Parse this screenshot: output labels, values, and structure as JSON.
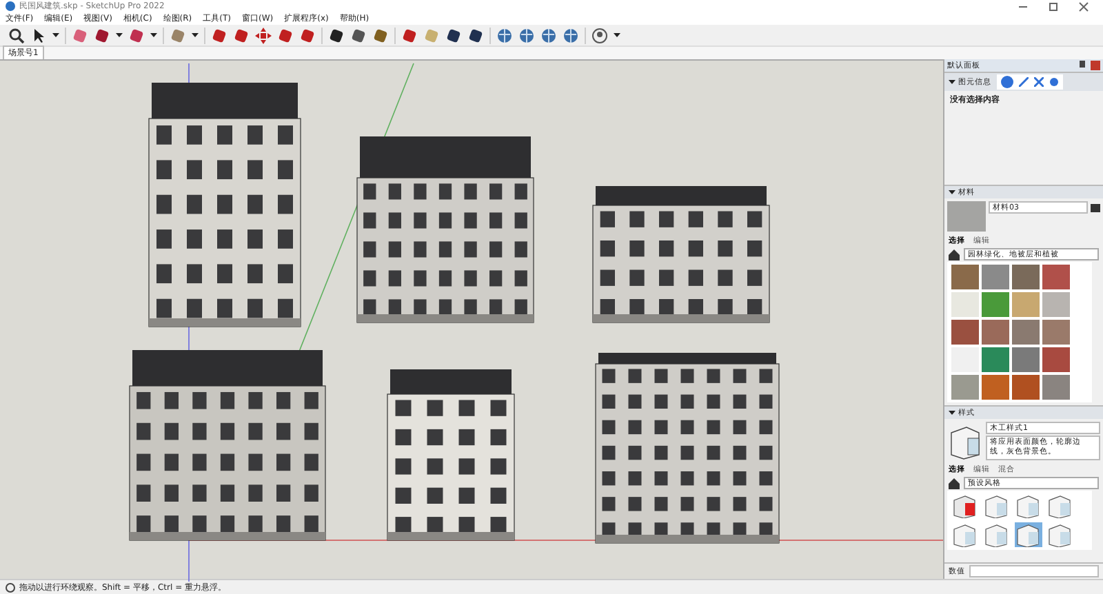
{
  "window": {
    "title": "民国风建筑.skp - SketchUp Pro 2022"
  },
  "menus": [
    "文件(F)",
    "编辑(E)",
    "视图(V)",
    "相机(C)",
    "绘图(R)",
    "工具(T)",
    "窗口(W)",
    "扩展程序(x)",
    "帮助(H)"
  ],
  "scene_tabs": [
    {
      "label": "场景号1",
      "selected": true
    }
  ],
  "tray": {
    "title": "默认面板",
    "entity_info": {
      "title": "图元信息",
      "text": "没有选择内容",
      "expanded": true
    },
    "materials": {
      "title": "材料",
      "name": "材料03",
      "tabs": [
        {
          "label": "选择",
          "selected": true
        },
        {
          "label": "编辑",
          "selected": false
        }
      ],
      "library": "园林绿化、地被层和植被"
    },
    "styles": {
      "title": "样式",
      "name": "木工样式1",
      "description": "将应用表面颜色，轮廓边线，灰色背景色。",
      "tabs": [
        {
          "label": "选择",
          "selected": true
        },
        {
          "label": "编辑",
          "selected": false
        },
        {
          "label": "混合",
          "selected": false
        }
      ],
      "library": "预设风格"
    },
    "measurements": {
      "label": "数值"
    }
  },
  "status_bar": {
    "text": "拖动以进行环绕观察。Shift = 平移，Ctrl = 重力悬浮。"
  }
}
